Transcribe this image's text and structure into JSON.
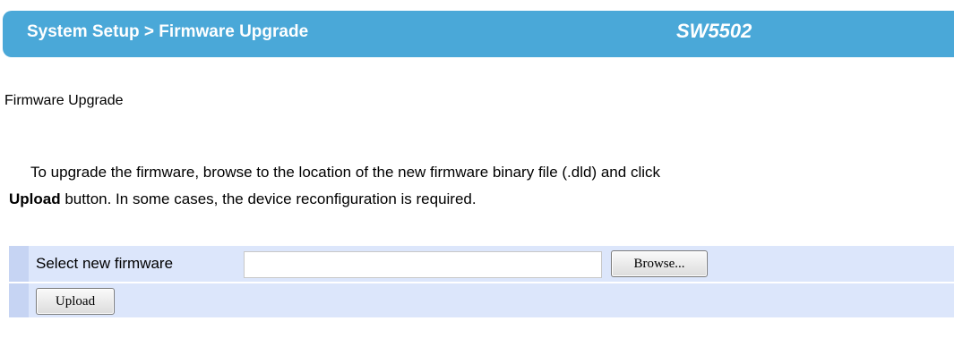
{
  "header": {
    "breadcrumb": "System Setup > Firmware Upgrade",
    "model": "SW5502"
  },
  "section": {
    "title": "Firmware Upgrade"
  },
  "description": {
    "line_part1": "To upgrade the firmware, browse to the location of the new firmware binary file (.dld) and click",
    "bold_word": "Upload",
    "line_part2": " button. In some cases, the device reconfiguration is required."
  },
  "form": {
    "select_label": "Select new firmware",
    "file_value": "",
    "browse_label": "Browse...",
    "upload_label": "Upload"
  },
  "colors": {
    "header_bg": "#4aa8d8",
    "row_bg": "#dce6fb",
    "row_marker": "#c6d4f3"
  }
}
